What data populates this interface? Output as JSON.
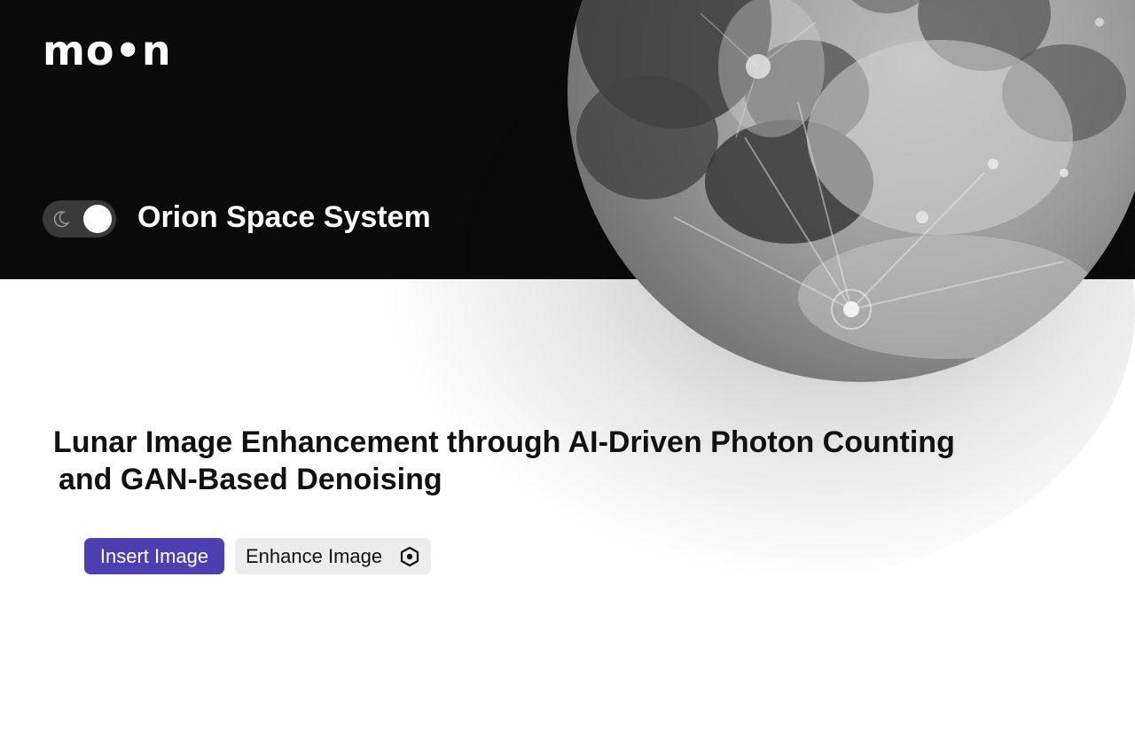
{
  "brand": {
    "logo_text": "mo•n"
  },
  "header": {
    "app_name": "Orion Space System",
    "theme_toggle": {
      "state": "dark",
      "icon": "moon-icon"
    }
  },
  "hero": {
    "title_line1": "Lunar Image Enhancement through AI-Driven Photon Counting",
    "title_line2": "and GAN-Based Denoising"
  },
  "actions": {
    "insert_label": "Insert Image",
    "enhance_label": "Enhance Image",
    "enhance_icon": "hexagon-icon"
  },
  "colors": {
    "header_bg": "#0b0b0b",
    "accent": "#4d3fb2",
    "secondary_button_bg": "#ececec"
  }
}
